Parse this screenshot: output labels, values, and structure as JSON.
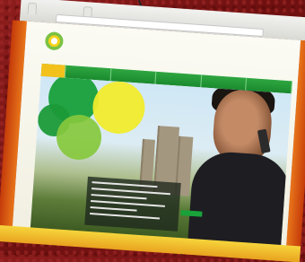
{
  "browser": {
    "tab_labels": [
      "",
      ""
    ]
  },
  "site": {
    "logo_icon": "bp-helios-logo-icon",
    "nav_items": [
      "",
      "",
      "",
      "",
      ""
    ]
  },
  "colors": {
    "frame_red": "#7a1414",
    "accent_green": "#1a8a2e",
    "accent_yellow": "#f1ec2c"
  }
}
